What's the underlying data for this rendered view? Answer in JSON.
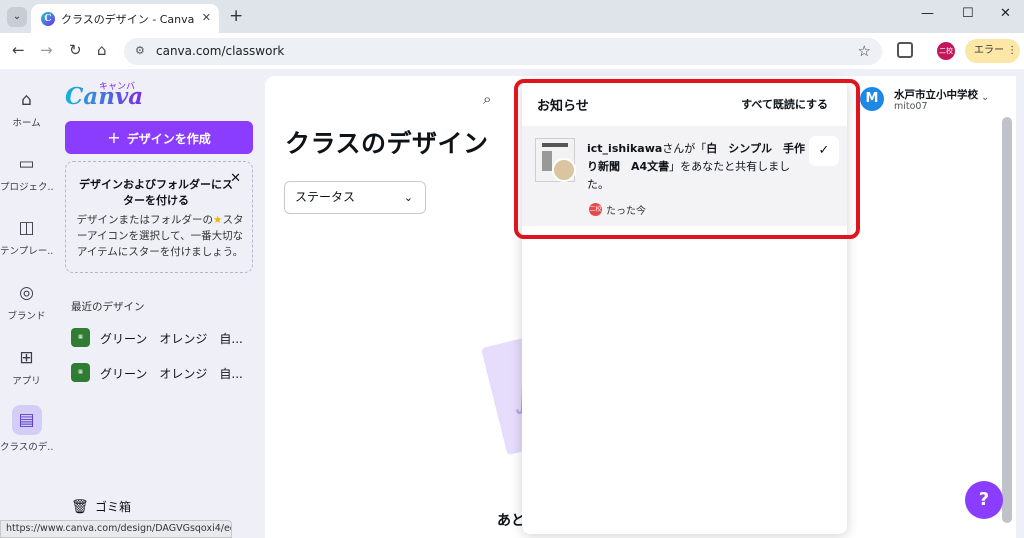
{
  "browser": {
    "tab_title": "クラスのデザイン - Canva",
    "favicon_letter": "C",
    "url": "canva.com/classwork",
    "profile_initials": "二校",
    "error_label": "エラー",
    "status_url": "https://www.canva.com/design/DAGVGsqoxi4/edit"
  },
  "rail": {
    "items": [
      {
        "label": "ホーム",
        "icon": "home-icon"
      },
      {
        "label": "プロジェク...",
        "icon": "folder-icon"
      },
      {
        "label": "テンプレー...",
        "icon": "template-icon"
      },
      {
        "label": "ブランド",
        "icon": "brand-icon"
      },
      {
        "label": "アプリ",
        "icon": "apps-icon"
      },
      {
        "label": "クラスのデ...",
        "icon": "inbox-icon"
      }
    ]
  },
  "panel": {
    "logo_text": "Canva",
    "logo_kana": "キャンバ",
    "create_label": "デザインを作成",
    "star_card": {
      "title": "デザインおよびフォルダーにスターを付ける",
      "body_before": "デザインまたはフォルダーの",
      "body_after": "スターアイコンを選択して、一番大切なアイテムにスターを付けましょう。"
    },
    "recent_heading": "最近のデザイン",
    "recent": [
      {
        "name": "グリーン　オレンジ　自..."
      },
      {
        "name": "グリーン　オレンジ　自..."
      }
    ],
    "trash_label": "ゴミ箱"
  },
  "main": {
    "title": "クラスのデザイン",
    "status_filter": "ステータス",
    "empty_text": "あと"
  },
  "account": {
    "avatar_letter": "M",
    "name": "水戸市立小中学校",
    "id": "mito07"
  },
  "notifications": {
    "title": "お知らせ",
    "mark_all_read": "すべて既読にする",
    "item": {
      "user": "ict_ishikawa",
      "text_mid": "さんが「",
      "design": "白　シンプル　手作り新聞　A4文書",
      "text_end": "」をあなたと共有しました。",
      "badge": "二校",
      "time": "たった今"
    }
  },
  "help_label": "?",
  "colors": {
    "brand_purple": "#8b3dff",
    "highlight_red": "#e0141e",
    "account_blue": "#1e88e5"
  }
}
